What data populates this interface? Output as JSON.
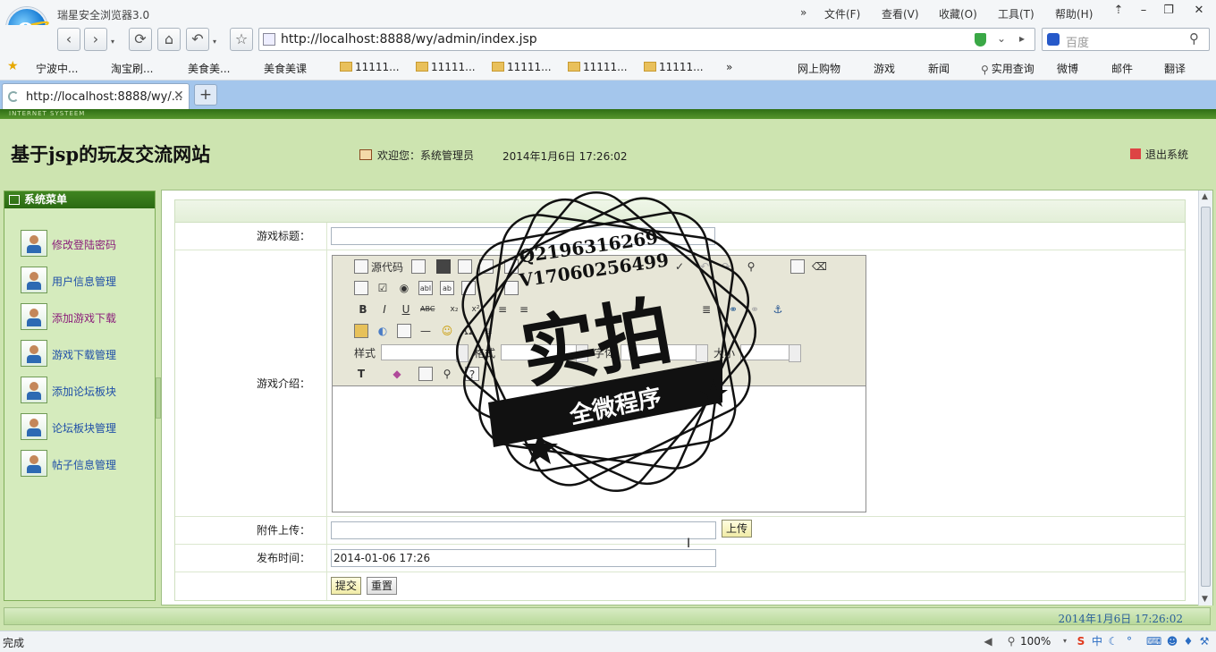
{
  "browser": {
    "title": "瑞星安全浏览器3.0",
    "menu": [
      "文件(F)",
      "查看(V)",
      "收藏(O)",
      "工具(T)",
      "帮助(H)"
    ],
    "menu_more": "»",
    "url": "http://localhost:8888/wy/admin/index.jsp",
    "search_placeholder": "百度",
    "bookmarks_left": [
      "宁波中...",
      "淘宝刷...",
      "美食美...",
      "美食美课",
      "11111...",
      "11111...",
      "11111...",
      "11111...",
      "11111..."
    ],
    "bookmarks_more": "»",
    "bookmarks_right": [
      "网上购物",
      "游戏",
      "新闻",
      "实用查询",
      "微博",
      "邮件",
      "翻译"
    ],
    "tab_title": "http://localhost:8888/wy/...",
    "status_text": "完成",
    "zoom": "100%"
  },
  "site": {
    "strip_text": "INTERNET SYSTEEM",
    "title": "基于jsp的玩友交流网站",
    "welcome": "欢迎您：系统管理员",
    "datetime": "2014年1月6日  17:26:02",
    "logout": "退出系统",
    "footer_datetime": "2014年1月6日  17:26:02"
  },
  "sidebar": {
    "heading": "系统菜单",
    "items": [
      {
        "label": "修改登陆密码",
        "color": "#8b1d7a"
      },
      {
        "label": "用户信息管理",
        "color": "#1f4fa8"
      },
      {
        "label": "添加游戏下载",
        "color": "#8b1d7a"
      },
      {
        "label": "游戏下载管理",
        "color": "#1f4fa8"
      },
      {
        "label": "添加论坛板块",
        "color": "#1f4fa8"
      },
      {
        "label": "论坛板块管理",
        "color": "#1f4fa8"
      },
      {
        "label": "帖子信息管理",
        "color": "#1f4fa8"
      }
    ]
  },
  "form": {
    "title_label": "游戏标题：",
    "title_value": "",
    "intro_label": "游戏介绍：",
    "attach_label": "附件上传：",
    "attach_value": "",
    "upload_button": "上传",
    "time_label": "发布时间：",
    "time_value": "2014-01-06 17:26",
    "submit_button": "提交",
    "reset_button": "重置"
  },
  "editor": {
    "source_label": "源代码",
    "style_label": "样式",
    "format_label": "格式",
    "font_label": "字体",
    "size_label": "大小"
  },
  "watermark": {
    "contact1": "Q2196316269",
    "contact2": "V17060256499",
    "main": "实拍",
    "banner": "全微程序"
  }
}
